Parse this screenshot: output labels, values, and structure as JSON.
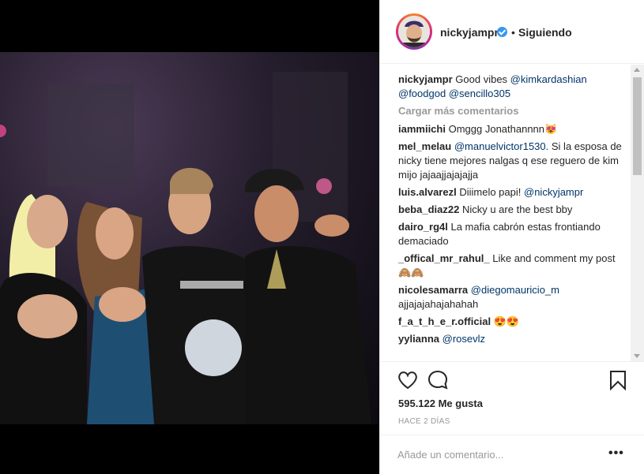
{
  "post": {
    "username": "nickyjampr",
    "separator": "•",
    "following_label": "Siguiendo",
    "caption": {
      "user": "nickyjampr",
      "text": "Good vibes",
      "mentions": [
        "@kimkardashian",
        "@foodgod",
        "@sencillo305"
      ]
    },
    "load_more_label": "Cargar más comentarios",
    "comments": [
      {
        "user": "iammiichi",
        "parts": [
          {
            "t": "Omggg Jonathannnn😻",
            "m": false
          }
        ]
      },
      {
        "user": "mel_melau",
        "parts": [
          {
            "t": "@manuelvictor1530",
            "m": true
          },
          {
            "t": ". Si la esposa de nicky tiene mejores nalgas q ese reguero de kim mijo jajaajjajajajja",
            "m": false
          }
        ]
      },
      {
        "user": "luis.alvarezl",
        "parts": [
          {
            "t": "Diiimelo papi!",
            "m": false
          },
          {
            "t": " @nickyjampr",
            "m": true
          }
        ]
      },
      {
        "user": "beba_diaz22",
        "parts": [
          {
            "t": "Nicky u are the best bby",
            "m": false
          }
        ]
      },
      {
        "user": "dairo_rg4l",
        "parts": [
          {
            "t": "La mafia cabrón estas frontiando demaciado",
            "m": false
          }
        ]
      },
      {
        "user": "_offical_mr_rahul_",
        "parts": [
          {
            "t": "Like and comment my post🙈🙈",
            "m": false
          }
        ]
      },
      {
        "user": "nicolesamarra",
        "parts": [
          {
            "t": "@diegomauricio_m",
            "m": true
          },
          {
            "t": " ajjajajahajahahah",
            "m": false
          }
        ]
      },
      {
        "user": "f_a_t_h_e_r.official",
        "parts": [
          {
            "t": "😍😍",
            "m": false
          }
        ]
      },
      {
        "user": "yylianna",
        "parts": [
          {
            "t": "@rosevlz",
            "m": true
          }
        ]
      }
    ],
    "likes_label": "595.122 Me gusta",
    "time_label": "HACE 2 DÍAS",
    "add_comment_placeholder": "Añade un comentario...",
    "more_label": "•••"
  },
  "icons": {
    "verified": "verified-badge-icon",
    "like": "heart-icon",
    "comment": "comment-bubble-icon",
    "save": "bookmark-icon",
    "more": "more-options-icon"
  },
  "colors": {
    "mention": "#003569",
    "verified": "#3897f0",
    "muted": "#999999"
  }
}
